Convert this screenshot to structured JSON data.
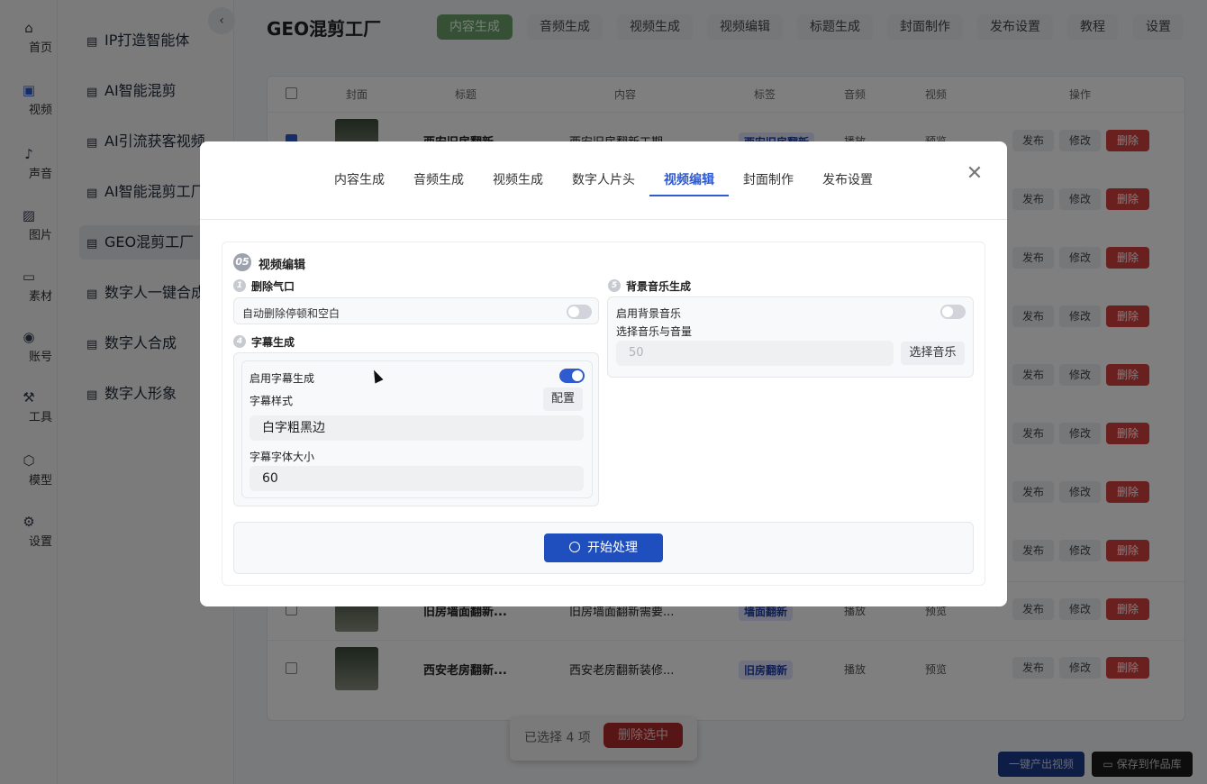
{
  "rail": [
    {
      "label": "首页",
      "icon": "home-icon"
    },
    {
      "label": "视频",
      "icon": "video-icon"
    },
    {
      "label": "声音",
      "icon": "sound-icon"
    },
    {
      "label": "图片",
      "icon": "image-icon"
    },
    {
      "label": "素材",
      "icon": "folder-icon"
    },
    {
      "label": "账号",
      "icon": "user-icon"
    },
    {
      "label": "工具",
      "icon": "wrench-icon"
    },
    {
      "label": "模型",
      "icon": "model-icon"
    },
    {
      "label": "设置",
      "icon": "gear-icon"
    }
  ],
  "subnav": [
    "IP打造智能体",
    "AI智能混剪",
    "AI引流获客视频",
    "AI智能混剪工厂",
    "GEO混剪工厂",
    "数字人一键合成",
    "数字人合成",
    "数字人形象"
  ],
  "header": {
    "title": "GEO混剪工厂",
    "tabs": [
      "内容生成",
      "音频生成",
      "视频生成",
      "视频编辑",
      "标题生成",
      "封面制作",
      "发布设置",
      "教程",
      "设置"
    ]
  },
  "table": {
    "headers": [
      "封面",
      "标题",
      "内容",
      "标签",
      "音频",
      "视频",
      "操作"
    ],
    "rows_visible": [
      {
        "title": "西安旧房翻新...",
        "content": "西安旧房翻新工期...",
        "tag": "西安旧房翻新",
        "audio": "播放",
        "video": "预览"
      },
      {
        "title": "旧房墙面翻新...",
        "content": "旧房墙面翻新需要...",
        "tag": "墙面翻新",
        "audio": "播放",
        "video": "预览"
      },
      {
        "title": "西安老房翻新...",
        "content": "西安老房翻新装修...",
        "tag": "旧房翻新",
        "audio": "播放",
        "video": "预览"
      }
    ],
    "btn_publish": "发布",
    "btn_edit": "修改",
    "btn_delete": "删除"
  },
  "bottom": {
    "selected": "已选择 4 项",
    "delete_selected": "删除选中",
    "one_click": "一键产出视频",
    "save_lib": "保存到作品库"
  },
  "modal": {
    "tabs": [
      "内容生成",
      "音频生成",
      "视频生成",
      "数字人片头",
      "视频编辑",
      "封面制作",
      "发布设置"
    ],
    "active_tab": "视频编辑",
    "section_num": "05",
    "section_title": "视频编辑",
    "s1_num": "1",
    "s1_title": "删除气口",
    "s1_toggle_label": "自动删除停顿和空白",
    "s4_num": "4",
    "s4_title": "字幕生成",
    "s4_enable": "启用字幕生成",
    "s4_style_label": "字幕样式",
    "s4_config": "配置",
    "s4_style_value": "白字粗黑边",
    "s4_size_label": "字幕字体大小",
    "s4_size_value": "60",
    "s5_num": "5",
    "s5_title": "背景音乐生成",
    "s5_enable": "启用背景音乐",
    "s5_select_label": "选择音乐与音量",
    "s5_volume": "50",
    "s5_select_btn": "选择音乐",
    "start": "开始处理"
  }
}
